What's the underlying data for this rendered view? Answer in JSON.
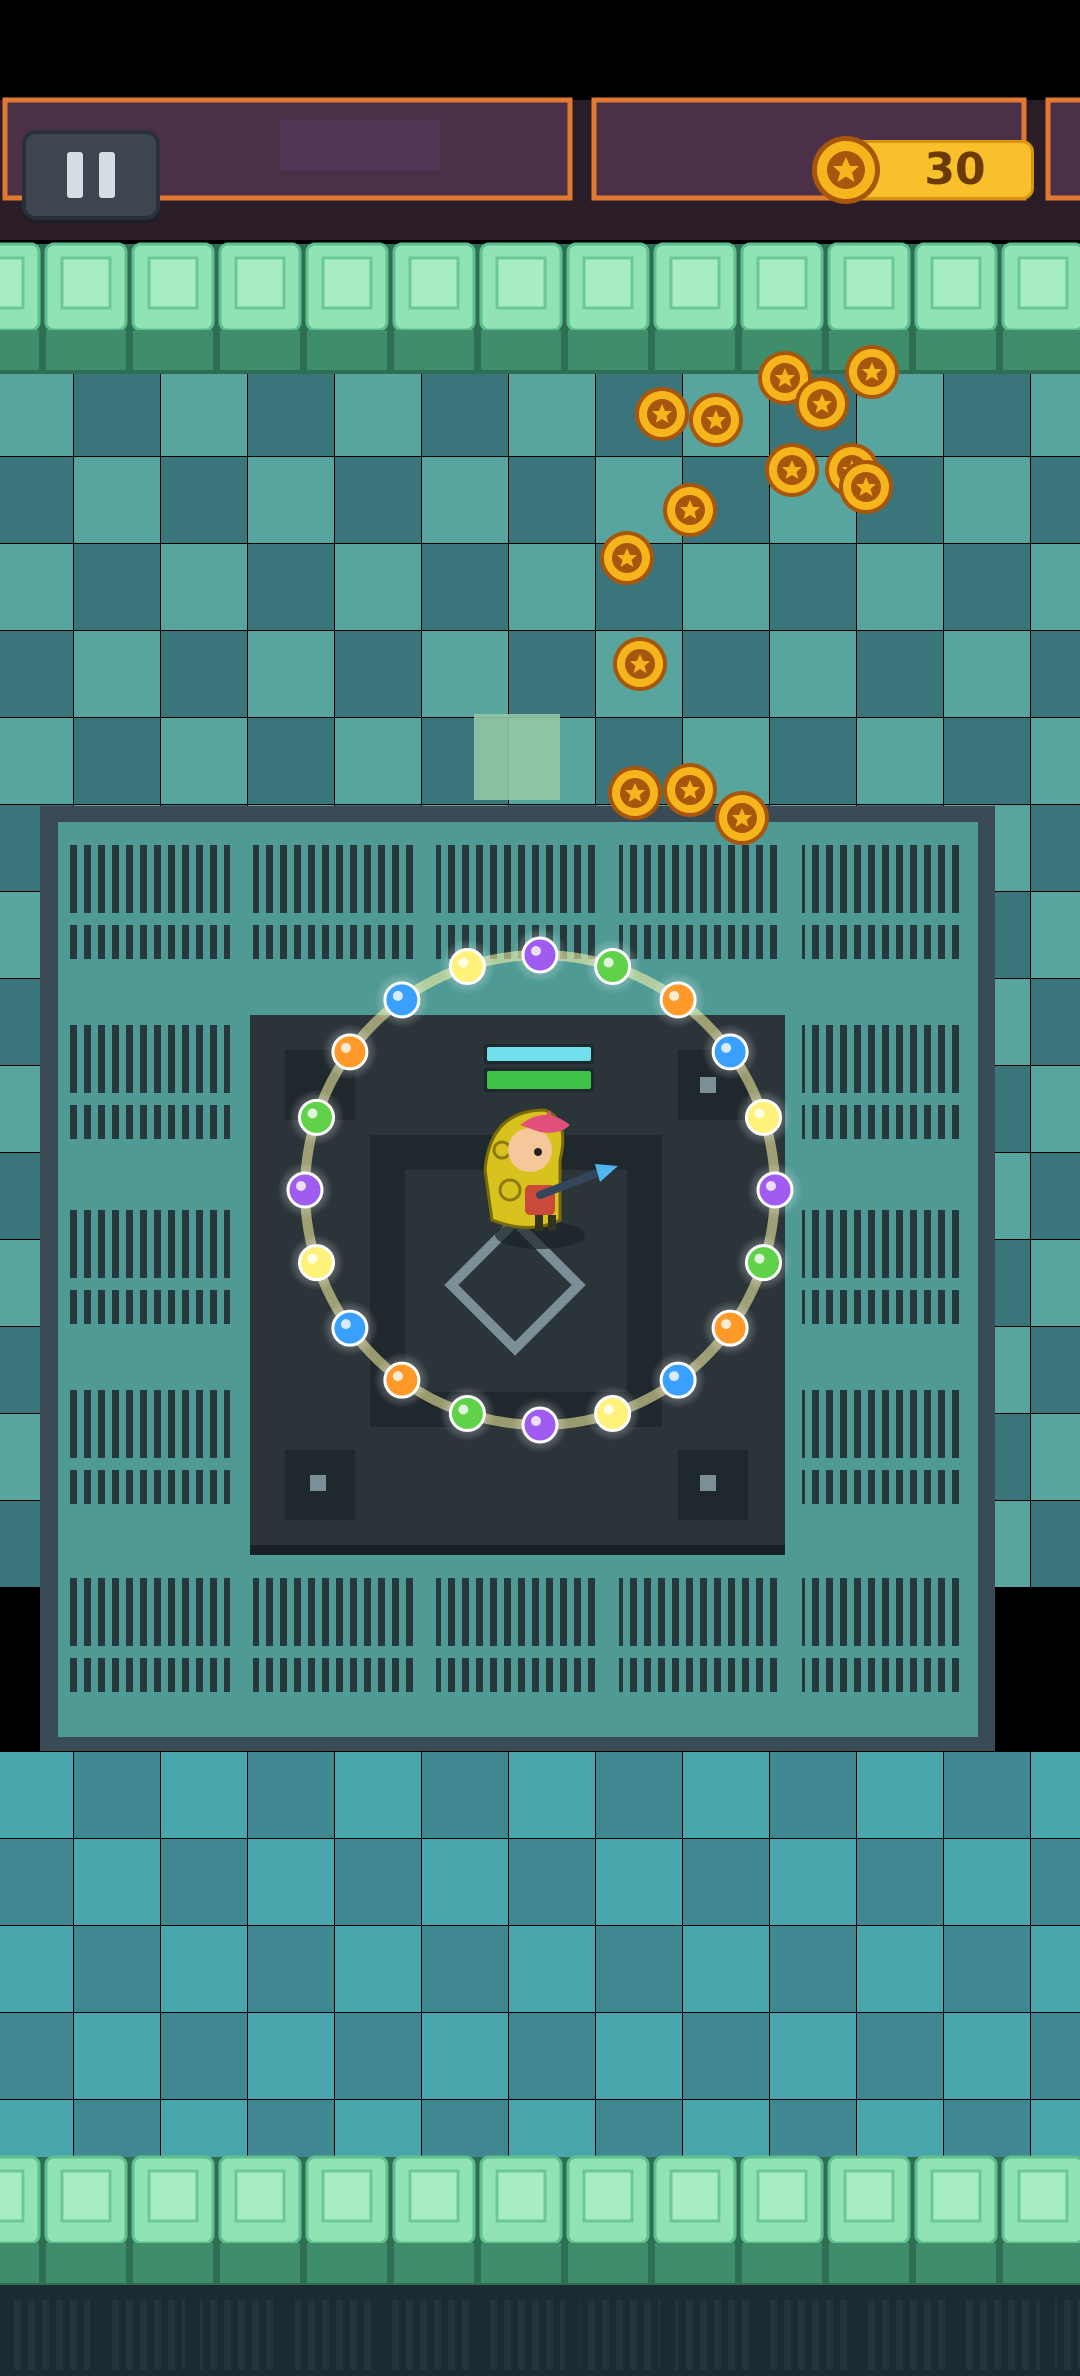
{
  "hud": {
    "coin_count": "30",
    "pause_icon": "pause-icon",
    "coin_icon": "star-coin-icon"
  },
  "colors": {
    "floor_light": "#5fb3ad",
    "floor_dark": "#3f7f86",
    "wall_top": "#8fe3b5",
    "wall_front": "#3f8d6a",
    "platform": "#4d9690",
    "pit": "#26323a",
    "coin_gold": "#f6b51c",
    "coin_rim": "#a8560c",
    "coin_counter_bg": "#f8c02a"
  },
  "scene": {
    "player": "hooded-hero",
    "orbit_orb_colors": [
      "#a05cf0",
      "#5fd24a",
      "#ff9a2a",
      "#3aa0ff",
      "#fff27a",
      "#a05cf0",
      "#5fd24a",
      "#ff9a2a",
      "#3aa0ff",
      "#fff27a",
      "#a05cf0",
      "#5fd24a",
      "#ff9a2a",
      "#3aa0ff",
      "#fff27a",
      "#a05cf0",
      "#5fd24a",
      "#ff9a2a",
      "#3aa0ff",
      "#fff27a"
    ],
    "pickup_coins": 16,
    "player_shield_bar": 1.0,
    "player_health_bar": 1.0
  }
}
